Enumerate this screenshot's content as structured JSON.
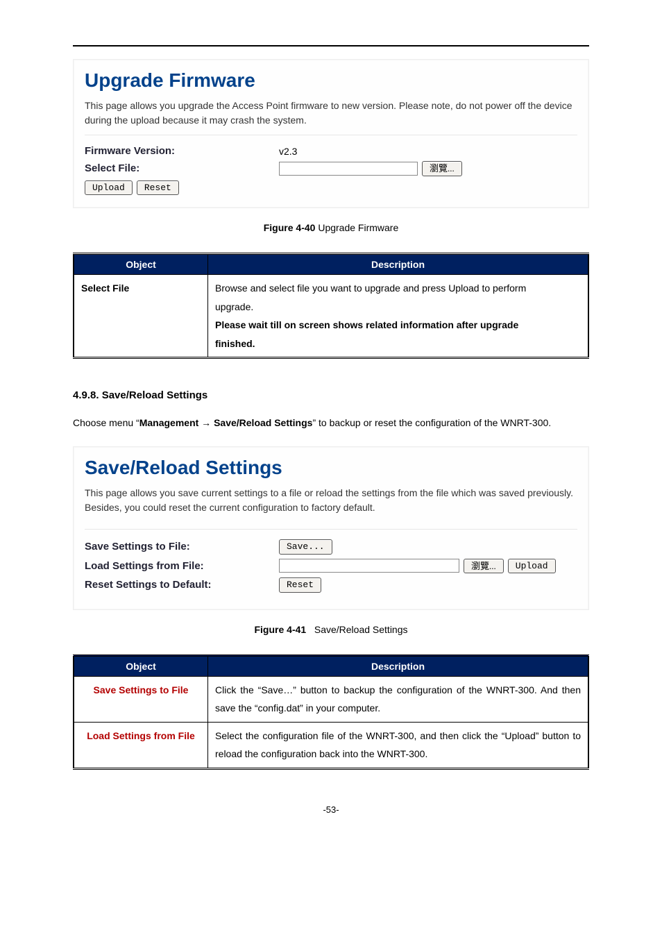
{
  "upgrade_panel": {
    "title": "Upgrade Firmware",
    "desc": "This page allows you upgrade the Access Point firmware to new version. Please note, do not power off the device during the upload because it may crash the system.",
    "firmware_label": "Firmware Version:",
    "firmware_value": "v2.3",
    "select_label": "Select File:",
    "browse_label": "瀏覽...",
    "upload_label": "Upload",
    "reset_label": "Reset"
  },
  "fig1": {
    "num": "Figure 4-40",
    "title": "Upgrade Firmware"
  },
  "table1": {
    "head_obj": "Object",
    "head_desc": "Description",
    "row_obj": "Select File",
    "row_desc_l1": "Browse and select file you want to upgrade and press Upload to perform",
    "row_desc_l2": "upgrade.",
    "row_desc_l3": "Please wait till on screen shows related information after upgrade",
    "row_desc_l4": "finished."
  },
  "section": {
    "heading": "4.9.8.  Save/Reload Settings",
    "p1a": "Choose menu “",
    "p1b": "Management → Save/Reload Settings",
    "p1c": "” to backup or reset the configuration of the WNRT-300."
  },
  "save_panel": {
    "title": "Save/Reload Settings",
    "desc": "This page allows you save current settings to a file or reload the settings from the file which was saved previously. Besides, you could reset the current configuration to factory default.",
    "save_label": "Save Settings to File:",
    "save_btn": "Save...",
    "load_label": "Load Settings from File:",
    "browse_label": "瀏覽...",
    "upload_label": "Upload",
    "reset_label": "Reset Settings to Default:",
    "reset_btn": "Reset"
  },
  "fig2": {
    "num": "Figure 4-41",
    "title": "Save/Reload Settings"
  },
  "table2": {
    "head_obj": "Object",
    "head_desc": "Description",
    "r1_obj": "Save Settings to File",
    "r1_desc": "Click the “Save…” button to backup the configuration of the WNRT-300. And then save the “config.dat” in your computer.",
    "r2_obj": "Load Settings from File",
    "r2_desc": "Select the configuration file of the WNRT-300, and then click the “Upload” button to reload the configuration back into the WNRT-300."
  },
  "footer_page": "-53-"
}
